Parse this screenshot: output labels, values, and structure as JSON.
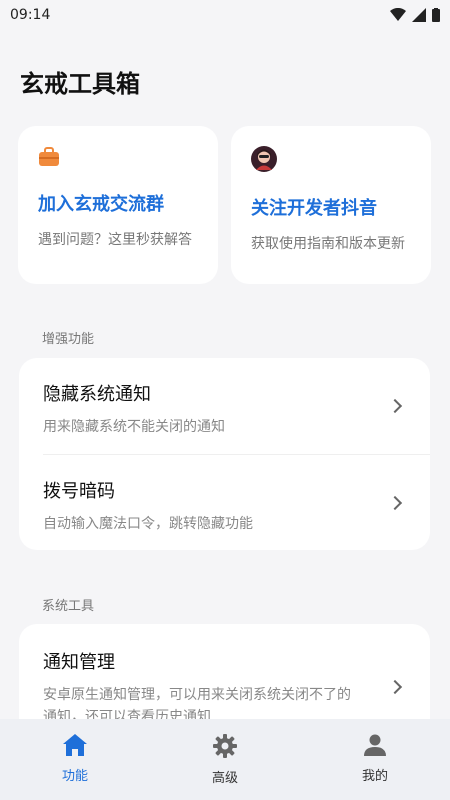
{
  "status_bar": {
    "time": "09:14"
  },
  "page_title": "玄戒工具箱",
  "quick_cards": [
    {
      "title": "加入玄戒交流群",
      "desc": "遇到问题？这里秒获解答"
    },
    {
      "title": "关注开发者抖音",
      "desc": "获取使用指南和版本更新"
    }
  ],
  "sections": [
    {
      "label": "增强功能",
      "items": [
        {
          "title": "隐藏系统通知",
          "desc": "用来隐藏系统不能关闭的通知"
        },
        {
          "title": "拨号暗码",
          "desc": "自动输入魔法口令，跳转隐藏功能"
        }
      ]
    },
    {
      "label": "系统工具",
      "items": [
        {
          "title": "通知管理",
          "desc": "安卓原生通知管理，可以用来关闭系统关闭不了的通知，还可以查看历史通知"
        }
      ]
    }
  ],
  "bottom_nav": [
    {
      "label": "功能",
      "icon": "home-icon",
      "active": true
    },
    {
      "label": "高级",
      "icon": "gear-icon",
      "active": false
    },
    {
      "label": "我的",
      "icon": "person-icon",
      "active": false
    }
  ],
  "colors": {
    "accent": "#1e6fd9",
    "background": "#f5f5f7",
    "card": "#ffffff"
  }
}
